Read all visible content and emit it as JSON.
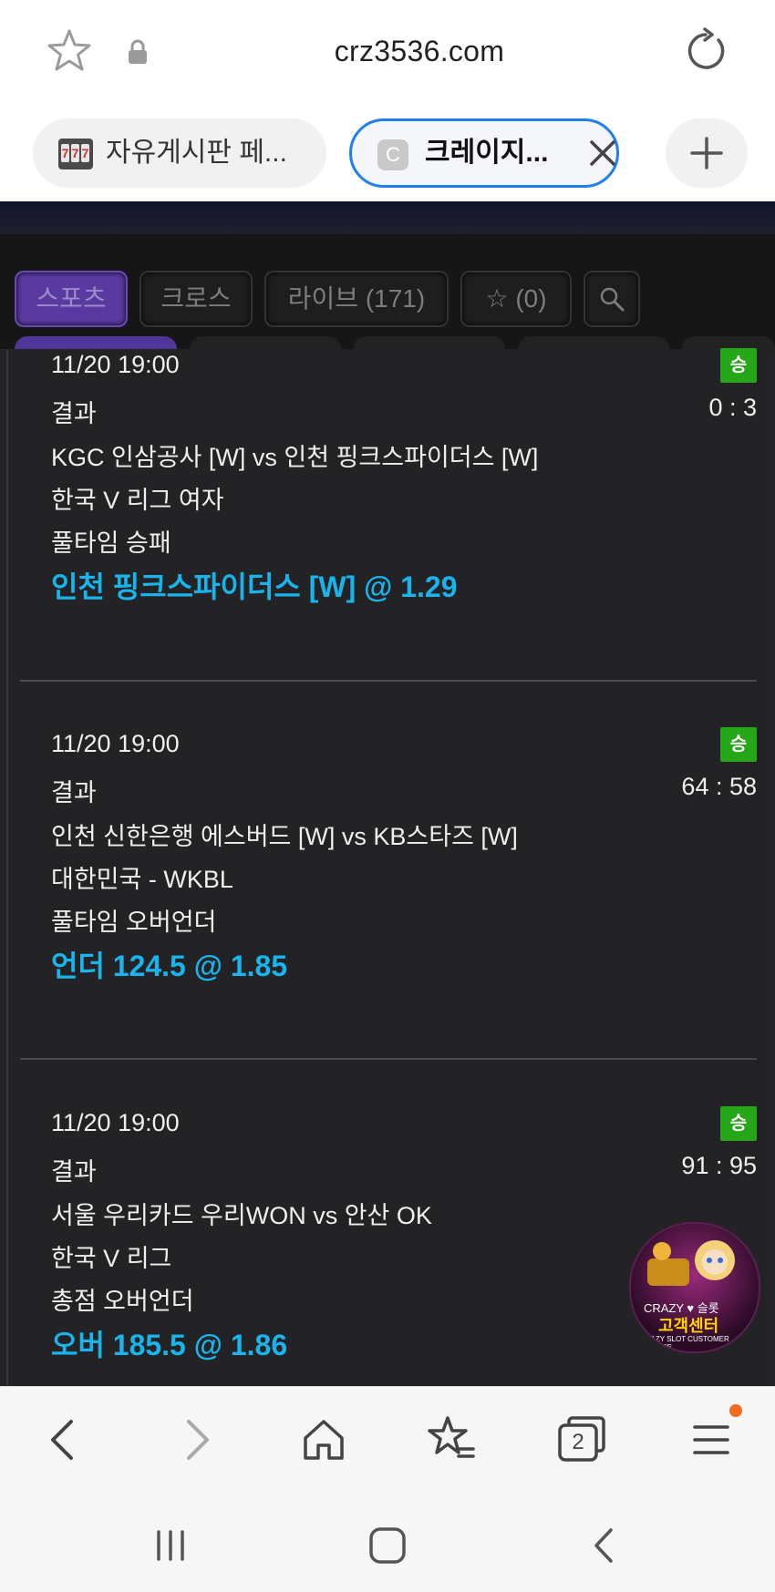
{
  "browser": {
    "url": "crz3536.com",
    "tabs": [
      {
        "label": "자유게시판 페..."
      },
      {
        "label": "크레이지...",
        "favicon_letter": "C"
      }
    ]
  },
  "site_nav": {
    "tabs": [
      {
        "label": "스포츠"
      },
      {
        "label": "크로스"
      },
      {
        "label": "라이브 (171)"
      },
      {
        "label": "☆ (0)"
      }
    ]
  },
  "bets": [
    {
      "datetime": "11/20 19:00",
      "badge": "승",
      "result_label": "결과",
      "score": "0 : 3",
      "match": "KGC 인삼공사 [W] vs 인천 핑크스파이더스 [W]",
      "league": "한국 V 리그 여자",
      "market": "풀타임 승패",
      "pick": "인천 핑크스파이더스 [W] @ 1.29"
    },
    {
      "datetime": "11/20 19:00",
      "badge": "승",
      "result_label": "결과",
      "score": "64 : 58",
      "match": "인천 신한은행 에스버드 [W] vs KB스타즈 [W]",
      "league": "대한민국 - WKBL",
      "market": "풀타임 오버언더",
      "pick": "언더 124.5 @ 1.85"
    },
    {
      "datetime": "11/20 19:00",
      "badge": "승",
      "result_label": "결과",
      "score": "91 : 95",
      "match": "서울 우리카드 우리WON vs 안산 OK",
      "league": "한국 V 리그",
      "market": "총점 오버언더",
      "pick": "오버 185.5 @ 1.86"
    }
  ],
  "customer_service": {
    "line1": "CRAZY ♥ 슬롯",
    "line2": "고객센터",
    "line3": "CRAZY SLOT CUSTOMER SERVICE"
  },
  "bottom_bar": {
    "tab_count": "2"
  },
  "colors": {
    "accent_pick": "#19b4ec",
    "win_badge": "#26a71a",
    "active_tab": "#5a3aa0",
    "browser_tab_border": "#1f7ff0"
  }
}
